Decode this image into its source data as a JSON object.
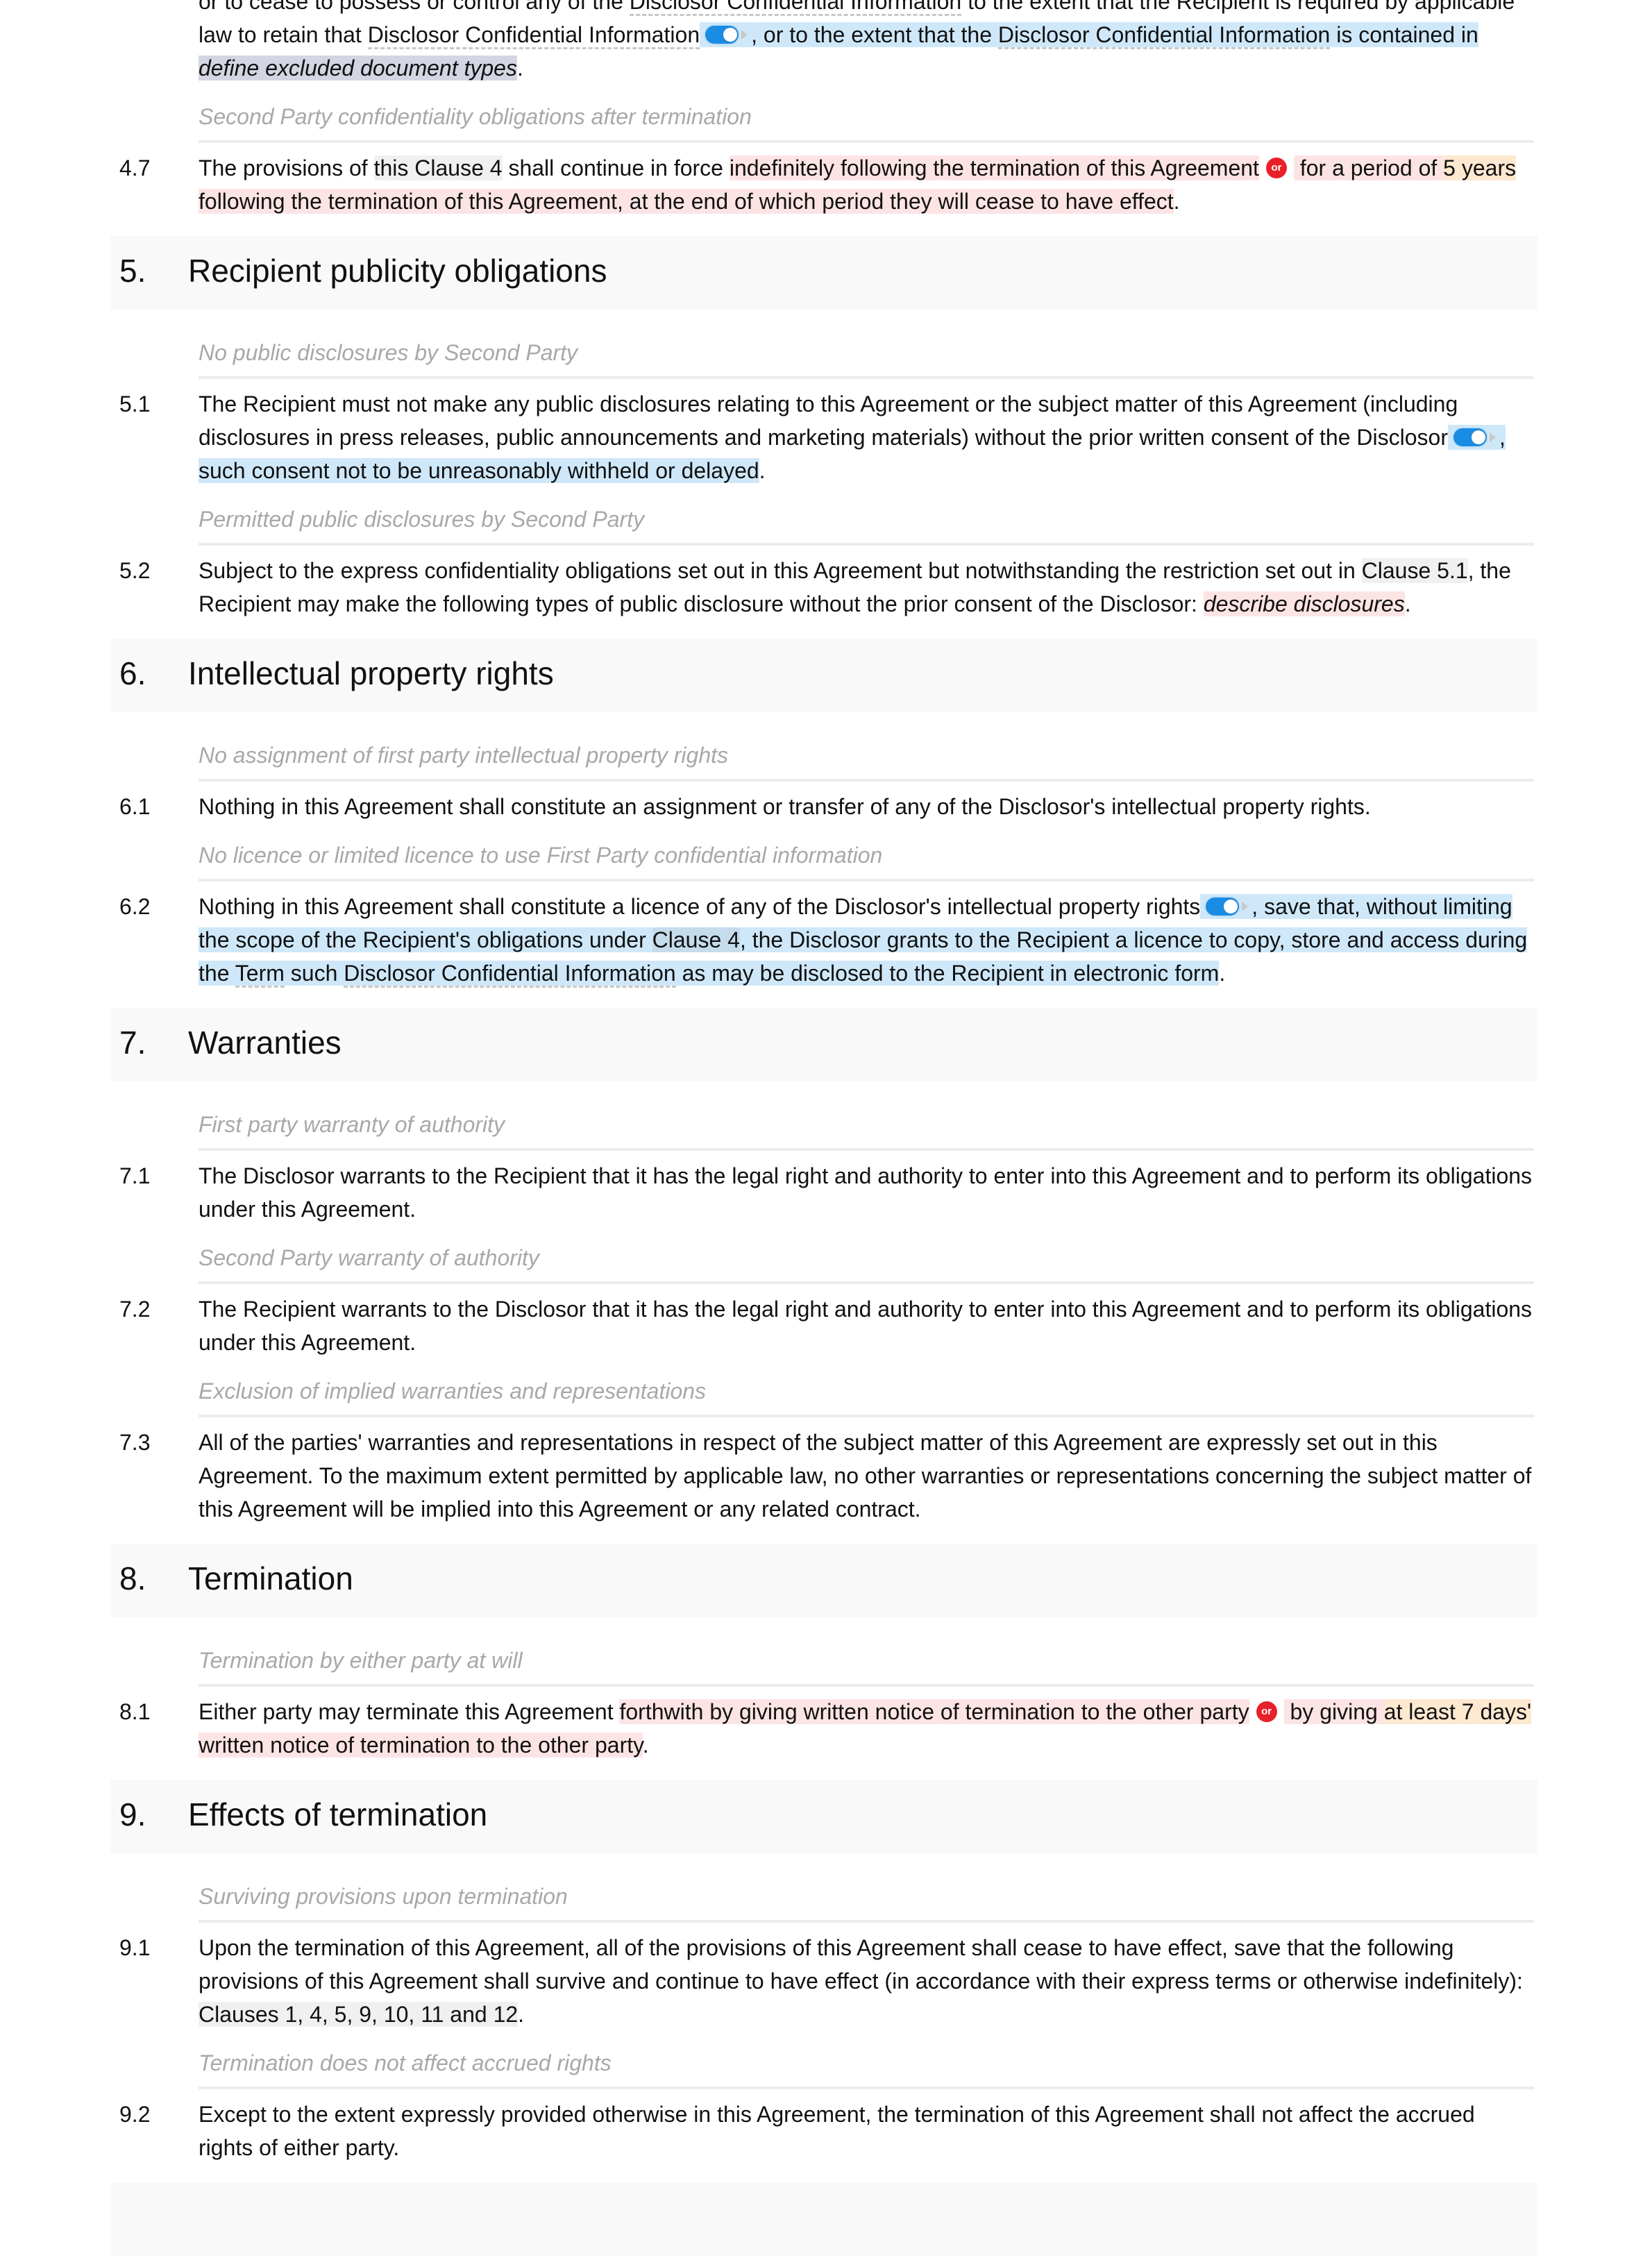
{
  "continuation": {
    "t1": "or to cease to possess or control any of the ",
    "def1": "Disclosor Confidential Information",
    "t2": " to the extent that the Recipient is required by applicable law to retain that ",
    "def2": "Disclosor Confidential Information",
    "opt1": ", or to the extent that the ",
    "def3": "Disclosor Confidential Information",
    "opt2": " is contained in ",
    "placeholder": "define excluded document types",
    "end": "."
  },
  "s4_7": {
    "subheading": "Second Party confidentiality obligations after termination",
    "number": "4.7",
    "t1": "The provisions of ",
    "ref": "this Clause 4",
    "t2": " shall continue in force ",
    "opt_a": "indefinitely following the termination of this Agreement",
    "or_label": "or",
    "opt_b1": " for a period of ",
    "opt_b_var": "5 years",
    "opt_b2": " following the termination of this Agreement, at the end of which period they will cease to have effect",
    "end": "."
  },
  "sections": {
    "s5": {
      "number": "5.",
      "title": "Recipient publicity obligations"
    },
    "s6": {
      "number": "6.",
      "title": "Intellectual property rights"
    },
    "s7": {
      "number": "7.",
      "title": "Warranties"
    },
    "s8": {
      "number": "8.",
      "title": "Termination"
    },
    "s9": {
      "number": "9.",
      "title": "Effects of termination"
    }
  },
  "s5_1": {
    "subheading": "No public disclosures by Second Party",
    "number": "5.1",
    "t1": "The Recipient must not make any public disclosures relating to this Agreement or the subject matter of this Agreement (including disclosures in press releases, public announcements and marketing materials) without the prior written consent of the Disclosor",
    "opt": ", such consent not to be unreasonably withheld or delayed",
    "end": "."
  },
  "s5_2": {
    "subheading": "Permitted public disclosures by Second Party",
    "number": "5.2",
    "t1": "Subject to the express confidentiality obligations set out in this Agreement but notwithstanding the restriction set out in ",
    "ref": "Clause 5.1",
    "t2": ", the Recipient may make the following types of public disclosure without the prior consent of the Disclosor: ",
    "placeholder": "describe disclosures",
    "end": "."
  },
  "s6_1": {
    "subheading": "No assignment of first party intellectual property rights",
    "number": "6.1",
    "text": "Nothing in this Agreement shall constitute an assignment or transfer of any of the Disclosor's intellectual property rights."
  },
  "s6_2": {
    "subheading": "No licence or limited licence to use First Party confidential information",
    "number": "6.2",
    "t1": "Nothing in this Agreement shall constitute a licence of any of the Disclosor's intellectual property rights",
    "opt1": ", save that, without limiting the scope of the Recipient's obligations under ",
    "ref": "Clause 4",
    "opt2": ", the Disclosor grants to the Recipient a licence to copy, store and access during the ",
    "def1": "Term",
    "opt3": " such ",
    "def2": "Disclosor Confidential Information",
    "opt4": " as may be disclosed to the Recipient in electronic form",
    "end": "."
  },
  "s7_1": {
    "subheading": "First party warranty of authority",
    "number": "7.1",
    "text": "The Disclosor warrants to the Recipient that it has the legal right and authority to enter into this Agreement and to perform its obligations under this Agreement."
  },
  "s7_2": {
    "subheading": "Second Party warranty of authority",
    "number": "7.2",
    "text": "The Recipient warrants to the Disclosor that it has the legal right and authority to enter into this Agreement and to perform its obligations under this Agreement."
  },
  "s7_3": {
    "subheading": "Exclusion of implied warranties and representations",
    "number": "7.3",
    "text": "All of the parties' warranties and representations in respect of the subject matter of this Agreement are expressly set out in this Agreement. To the maximum extent permitted by applicable law, no other warranties or representations concerning the subject matter of this Agreement will be implied into this Agreement or any related contract."
  },
  "s8_1": {
    "subheading": "Termination by either party at will",
    "number": "8.1",
    "t1": "Either party may terminate this Agreement ",
    "opt_a": "forthwith by giving written notice of termination to the other party",
    "or_label": "or",
    "opt_b1": " by giving ",
    "opt_b_var": "at least 7 days'",
    "opt_b2": " written notice of termination to the other party",
    "end": "."
  },
  "s9_1": {
    "subheading": "Surviving provisions upon termination",
    "number": "9.1",
    "t1": "Upon the termination of this Agreement, all of the provisions of this Agreement shall cease to have effect, save that the following provisions of this Agreement shall survive and continue to have effect (in accordance with their express terms or otherwise indefinitely): ",
    "ref": "Clauses 1, 4, 5, 9, 10, 11 and 12",
    "end": "."
  },
  "s9_2": {
    "subheading": "Termination does not affect accrued rights",
    "number": "9.2",
    "text": "Except to the extent expressly provided otherwise in this Agreement, the termination of this Agreement shall not affect the accrued rights of either party."
  },
  "colors": {
    "optional_highlight": "#cfe8f9",
    "alternative_highlight": "#fde4e4",
    "variable_highlight": "#fde8d0",
    "reference_highlight": "#f0f0f0",
    "placeholder_highlight": "#d3d5e2",
    "toggle_on": "#1a8ce3",
    "or_badge": "#e8202a",
    "heading_bar": "#f9f9f9"
  }
}
